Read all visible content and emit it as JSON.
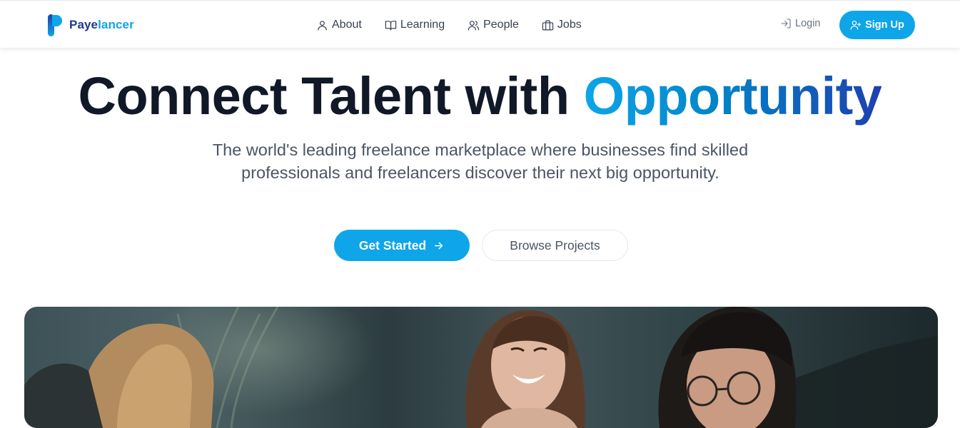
{
  "brand": {
    "name_part1": "Paye",
    "name_part2": "lancer",
    "primary_color": "#0ea5e9",
    "dark_color": "#1e3a8a"
  },
  "nav": {
    "items": [
      {
        "label": "About",
        "icon": "user-icon"
      },
      {
        "label": "Learning",
        "icon": "book-open-icon"
      },
      {
        "label": "People",
        "icon": "users-icon"
      },
      {
        "label": "Jobs",
        "icon": "briefcase-icon"
      }
    ],
    "login_label": "Login",
    "login_icon": "log-in-icon",
    "signup_label": "Sign Up",
    "signup_icon": "user-plus-icon"
  },
  "hero": {
    "title_main": "Connect Talent with ",
    "title_accent": "Opportunity",
    "subtitle": "The world's leading freelance marketplace where businesses find skilled professionals and freelancers discover their next big opportunity.",
    "primary_cta": "Get Started",
    "primary_cta_icon": "arrow-right-icon",
    "secondary_cta": "Browse Projects",
    "image_alt": "people-laughing-photo"
  }
}
